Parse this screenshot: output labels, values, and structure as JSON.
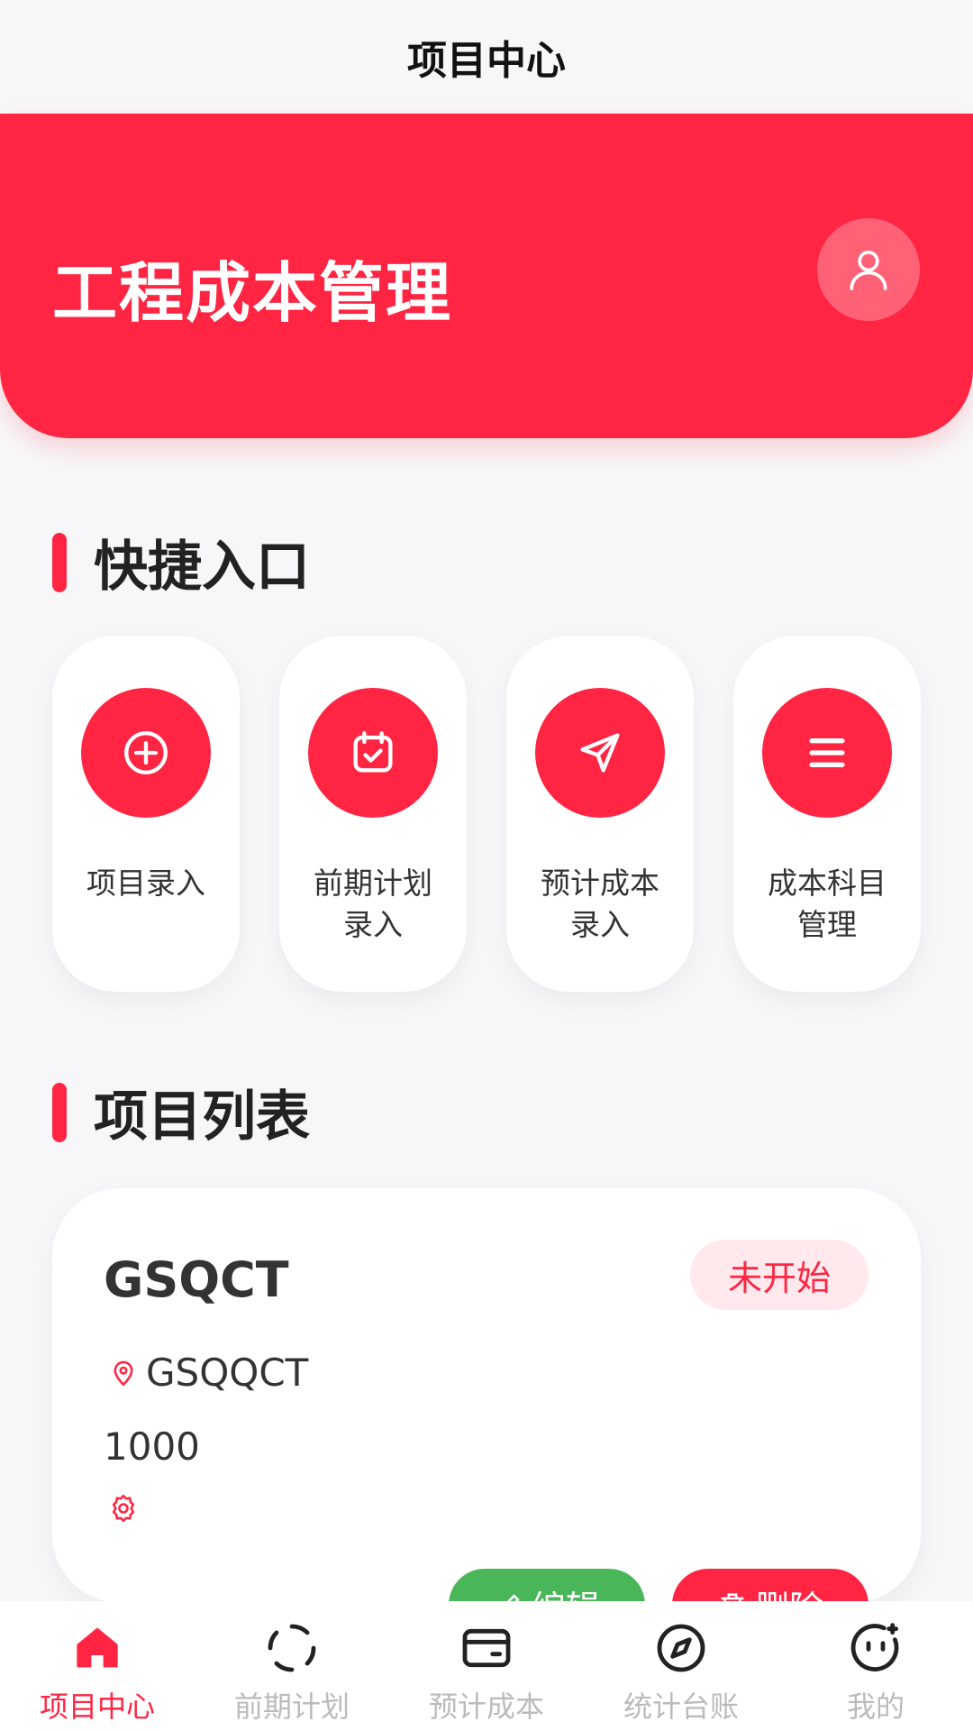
{
  "navbar": {
    "title": "项目中心"
  },
  "hero": {
    "title": "工程成本管理"
  },
  "quick": {
    "title": "快捷入口",
    "items": [
      {
        "label": "项目录入",
        "icon": "plus-circle-icon"
      },
      {
        "label": "前期计划录入",
        "icon": "calendar-check-icon"
      },
      {
        "label": "预计成本录入",
        "icon": "send-icon"
      },
      {
        "label": "成本科目管理",
        "icon": "menu-icon"
      }
    ]
  },
  "projects": {
    "title": "项目列表",
    "items": [
      {
        "name": "GSQCT",
        "status": "未开始",
        "location": "GSQQCT",
        "amount": "1000",
        "edit_label": "编辑",
        "delete_label": "删除"
      }
    ]
  },
  "tabbar": {
    "items": [
      {
        "label": "项目中心",
        "icon": "home-icon",
        "active": true
      },
      {
        "label": "前期计划",
        "icon": "loading-circle-icon",
        "active": false
      },
      {
        "label": "预计成本",
        "icon": "wallet-icon",
        "active": false
      },
      {
        "label": "统计台账",
        "icon": "compass-icon",
        "active": false
      },
      {
        "label": "我的",
        "icon": "face-icon",
        "active": false
      }
    ]
  },
  "colors": {
    "accent": "#ff2543",
    "success": "#49b65a",
    "badge_bg": "#ffe9ec",
    "inactive": "#bbbbbb"
  }
}
